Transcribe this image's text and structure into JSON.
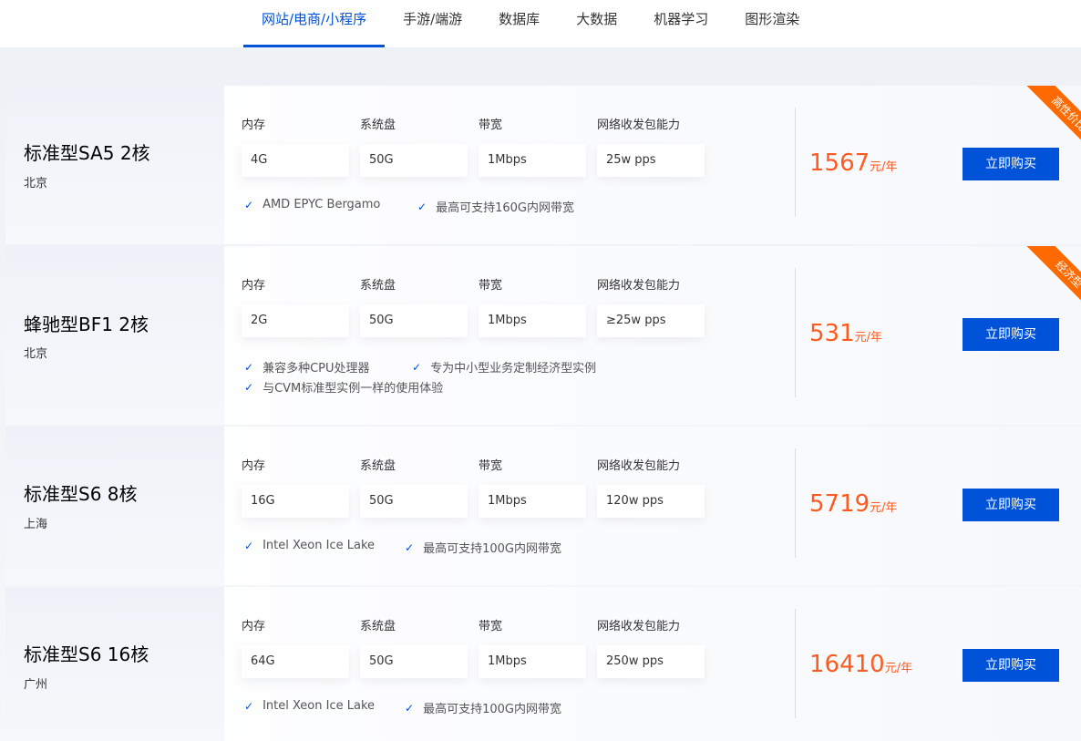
{
  "tabs": [
    {
      "label": "网站/电商/小程序",
      "active": true
    },
    {
      "label": "手游/端游",
      "active": false
    },
    {
      "label": "数据库",
      "active": false
    },
    {
      "label": "大数据",
      "active": false
    },
    {
      "label": "机器学习",
      "active": false
    },
    {
      "label": "图形渲染",
      "active": false
    }
  ],
  "spec_labels": {
    "memory": "内存",
    "disk": "系统盘",
    "bandwidth": "带宽",
    "pps": "网络收发包能力"
  },
  "products": [
    {
      "name": "标准型SA5 2核",
      "region": "北京",
      "memory": "4G",
      "disk": "50G",
      "bandwidth": "1Mbps",
      "pps": "25w pps",
      "features": [
        "AMD EPYC Bergamo",
        "最高可支持160G内网带宽"
      ],
      "price": "1567",
      "unit": "元/年",
      "buy": "立即购买",
      "tag": "高性价比"
    },
    {
      "name": "蜂驰型BF1 2核",
      "region": "北京",
      "memory": "2G",
      "disk": "50G",
      "bandwidth": "1Mbps",
      "pps": "≥25w pps",
      "features": [
        "兼容多种CPU处理器",
        "专为中小型业务定制经济型实例",
        "与CVM标准型实例一样的使用体验"
      ],
      "price": "531",
      "unit": "元/年",
      "buy": "立即购买",
      "tag": "经济型"
    },
    {
      "name": "标准型S6 8核",
      "region": "上海",
      "memory": "16G",
      "disk": "50G",
      "bandwidth": "1Mbps",
      "pps": "120w pps",
      "features": [
        "Intel Xeon Ice Lake",
        "最高可支持100G内网带宽"
      ],
      "price": "5719",
      "unit": "元/年",
      "buy": "立即购买",
      "tag": ""
    },
    {
      "name": "标准型S6 16核",
      "region": "广州",
      "memory": "64G",
      "disk": "50G",
      "bandwidth": "1Mbps",
      "pps": "250w pps",
      "features": [
        "Intel Xeon Ice Lake",
        "最高可支持100G内网带宽"
      ],
      "price": "16410",
      "unit": "元/年",
      "buy": "立即购买",
      "tag": ""
    }
  ],
  "colors": {
    "accent": "#0052d9",
    "price": "#ff5a1f",
    "ribbon": "#ff6a00"
  }
}
